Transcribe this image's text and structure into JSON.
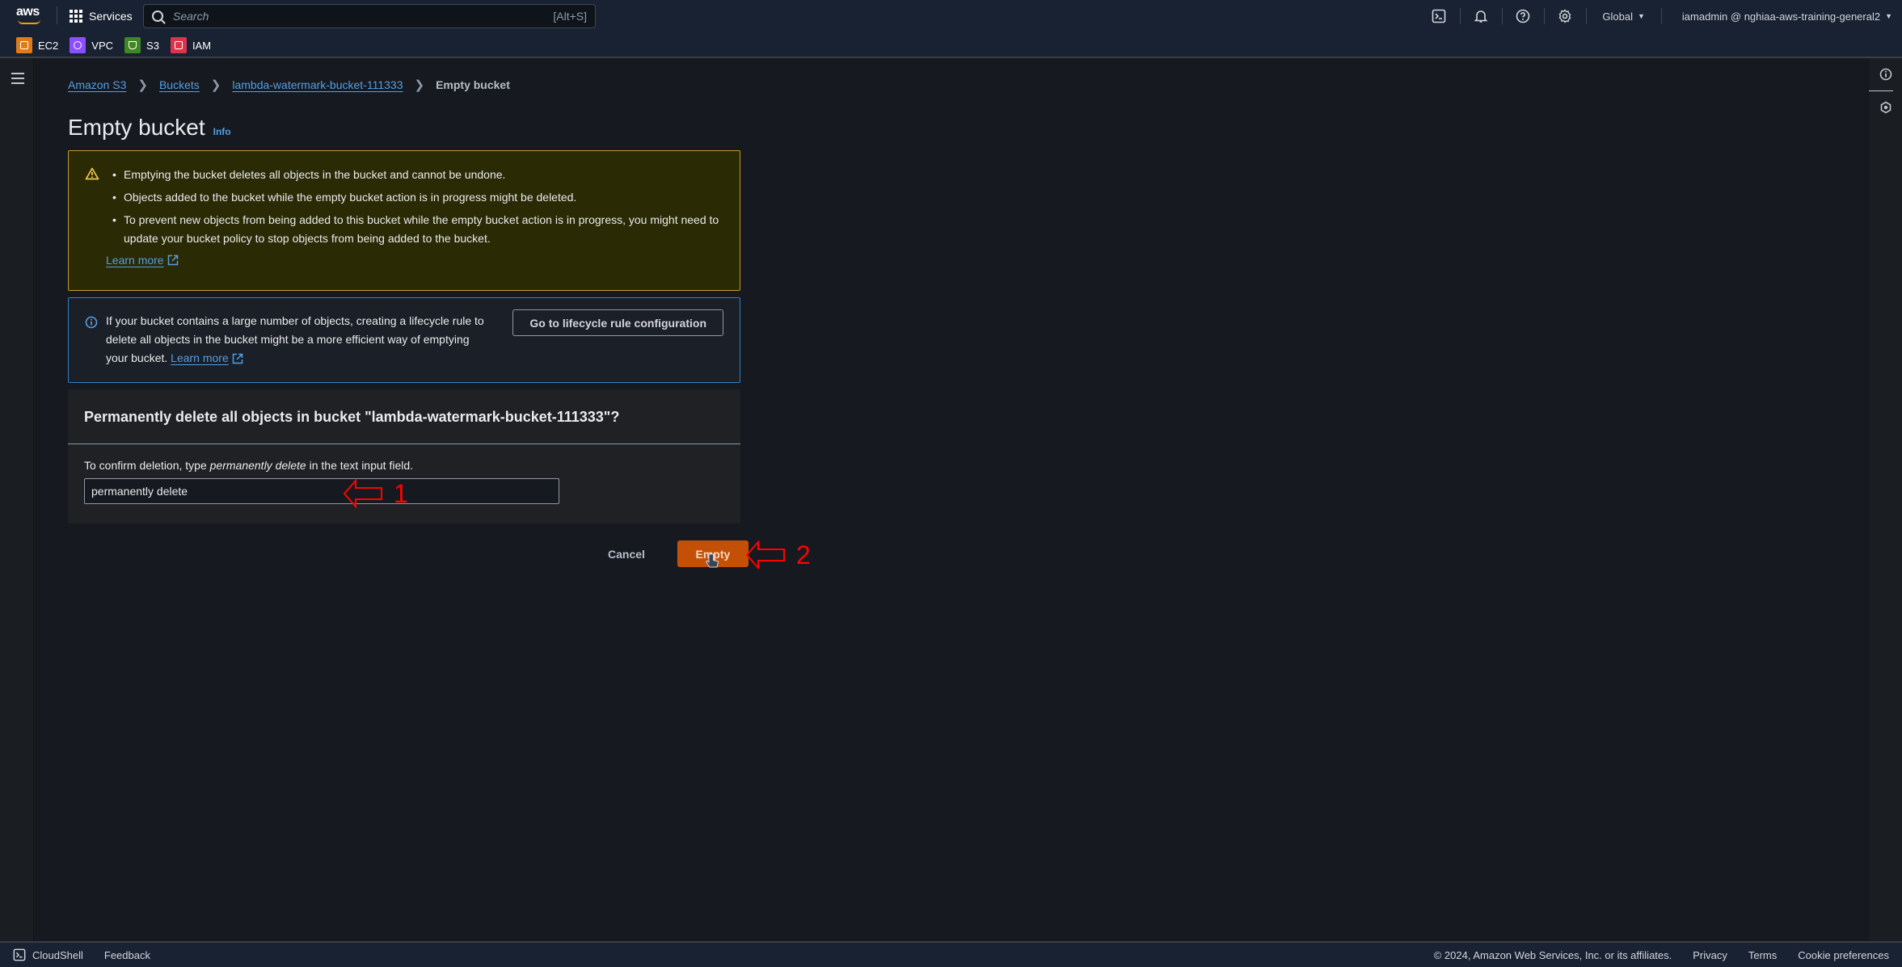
{
  "topnav": {
    "logo": "aws",
    "services_label": "Services",
    "search_placeholder": "Search",
    "search_shortcut": "[Alt+S]",
    "region_label": "Global",
    "account_label": "iamadmin @ nghiaa-aws-training-general2",
    "favorites": [
      {
        "label": "EC2",
        "color": "#e07b18"
      },
      {
        "label": "VPC",
        "color": "#8c4fff"
      },
      {
        "label": "S3",
        "color": "#3f8624"
      },
      {
        "label": "IAM",
        "color": "#dd344c"
      }
    ]
  },
  "breadcrumb": {
    "items": [
      "Amazon S3",
      "Buckets",
      "lambda-watermark-bucket-111333"
    ],
    "current": "Empty bucket"
  },
  "page": {
    "title": "Empty bucket",
    "info_label": "Info"
  },
  "warning": {
    "bullets": [
      "Emptying the bucket deletes all objects in the bucket and cannot be undone.",
      "Objects added to the bucket while the empty bucket action is in progress might be deleted.",
      "To prevent new objects from being added to this bucket while the empty bucket action is in progress, you might need to update your bucket policy to stop objects from being added to the bucket."
    ],
    "learn_more": "Learn more"
  },
  "info": {
    "text": "If your bucket contains a large number of objects, creating a lifecycle rule to delete all objects in the bucket might be a more efficient way of emptying your bucket.",
    "learn_more": "Learn more",
    "button_label": "Go to lifecycle rule configuration"
  },
  "confirm": {
    "heading": "Permanently delete all objects in bucket \"lambda-watermark-bucket-111333\"?",
    "label_prefix": "To confirm deletion, type ",
    "label_emphasis": "permanently delete",
    "label_suffix": " in the text input field.",
    "input_value": "permanently delete"
  },
  "actions": {
    "cancel_label": "Cancel",
    "empty_label": "Empty"
  },
  "annotations": {
    "step1": "1",
    "step2": "2"
  },
  "footer": {
    "cloudshell_label": "CloudShell",
    "feedback_label": "Feedback",
    "copyright": "© 2024, Amazon Web Services, Inc. or its affiliates.",
    "privacy": "Privacy",
    "terms": "Terms",
    "cookie": "Cookie preferences"
  }
}
